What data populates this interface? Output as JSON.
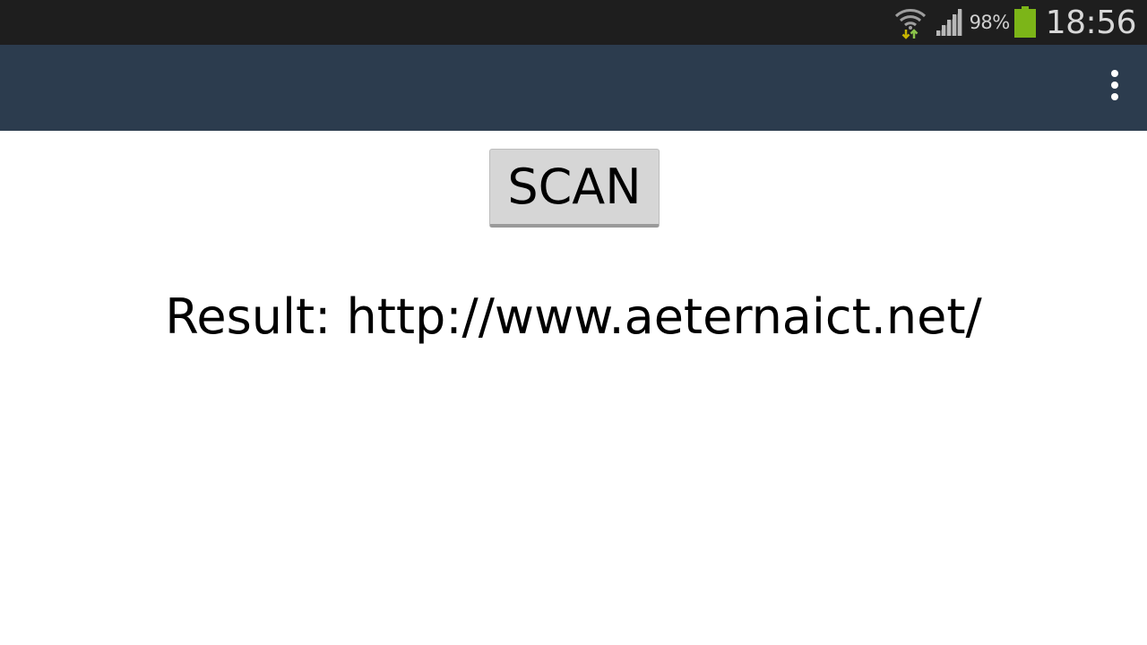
{
  "status_bar": {
    "battery_percent": "98%",
    "battery_level": 0.98,
    "time": "18:56",
    "icons": [
      "wifi-data-icon",
      "signal-icon",
      "battery-icon"
    ],
    "colors": {
      "background": "#1e1e1e",
      "battery": "#7cb518",
      "data_arrows": "#c8b400"
    }
  },
  "action_bar": {
    "background": "#2c3c4e",
    "menu_icon": "overflow-menu-icon"
  },
  "main": {
    "scan_label": "SCAN",
    "result_text": "Result: http://www.aeternaict.net/"
  }
}
